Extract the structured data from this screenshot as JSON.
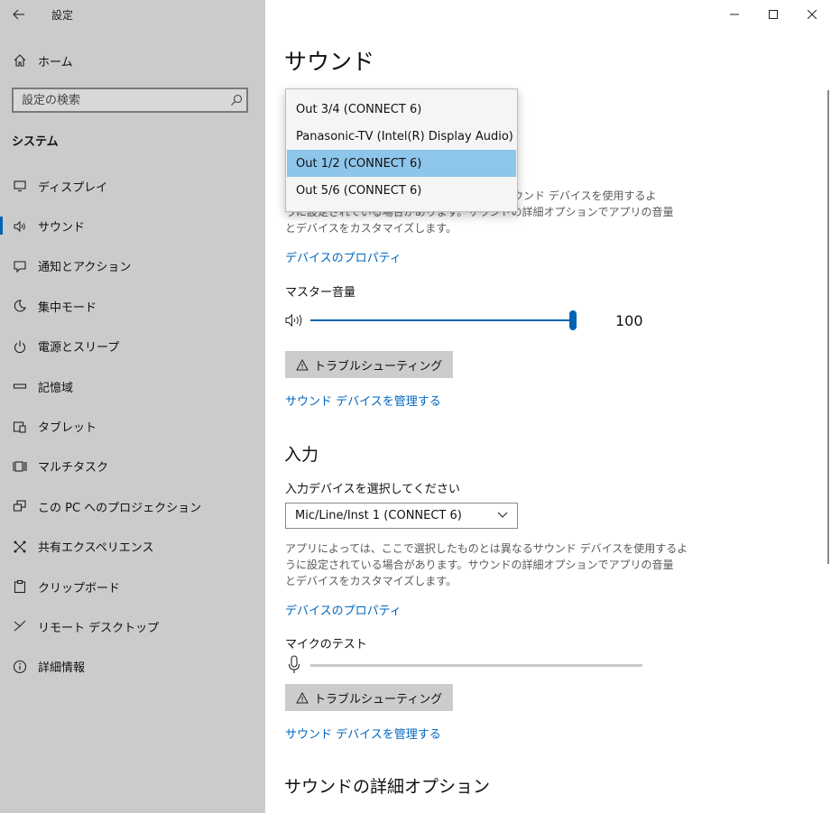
{
  "app": {
    "title": "設定"
  },
  "window_controls": {
    "minimize": "—",
    "maximize": "☐",
    "close": "✕"
  },
  "sidebar": {
    "home_label": "ホーム",
    "search_placeholder": "設定の検索",
    "section_title": "システム",
    "items": [
      {
        "label": "ディスプレイ",
        "icon": "display-icon"
      },
      {
        "label": "サウンド",
        "icon": "speaker-icon",
        "active": true
      },
      {
        "label": "通知とアクション",
        "icon": "notification-icon"
      },
      {
        "label": "集中モード",
        "icon": "moon-icon"
      },
      {
        "label": "電源とスリープ",
        "icon": "power-icon"
      },
      {
        "label": "記憶域",
        "icon": "storage-icon"
      },
      {
        "label": "タブレット",
        "icon": "tablet-icon"
      },
      {
        "label": "マルチタスク",
        "icon": "multitask-icon"
      },
      {
        "label": "この PC へのプロジェクション",
        "icon": "projection-icon"
      },
      {
        "label": "共有エクスペリエンス",
        "icon": "shared-icon"
      },
      {
        "label": "クリップボード",
        "icon": "clipboard-icon"
      },
      {
        "label": "リモート デスクトップ",
        "icon": "remote-icon"
      },
      {
        "label": "詳細情報",
        "icon": "info-icon"
      }
    ]
  },
  "main": {
    "page_title": "サウンド",
    "output": {
      "description_partial": "ウンド デバイスを使用するよう に設定されている場合があります。サウンドの詳細オプションでアプリの音量とデバイスをカスタマイズします。",
      "desc_line1": "ウンド デバイスを使用するよ",
      "desc_line2": "うに設定されている場合があります。サウンドの詳細オプションでアプリの音量",
      "desc_line3": "とデバイスをカスタマイズします。",
      "device_properties_link": "デバイスのプロパティ",
      "master_volume_label": "マスター音量",
      "volume_value": "100",
      "volume_level": 1.0,
      "troubleshoot_label": "トラブルシューティング",
      "manage_devices_link": "サウンド デバイスを管理する",
      "dropdown_options": [
        "Out 3/4 (CONNECT 6)",
        "Panasonic-TV (Intel(R) Display Audio)",
        "Out 1/2 (CONNECT 6)",
        "Out 5/6 (CONNECT 6)"
      ],
      "dropdown_selected_index": 2
    },
    "input": {
      "heading": "入力",
      "select_label": "入力デバイスを選択してください",
      "selected_device": "Mic/Line/Inst 1 (CONNECT 6)",
      "desc_line1": "アプリによっては、ここで選択したものとは異なるサウンド デバイスを使用するよ",
      "desc_line2": "うに設定されている場合があります。サウンドの詳細オプションでアプリの音量",
      "desc_line3": "とデバイスをカスタマイズします。",
      "device_properties_link": "デバイスのプロパティ",
      "mic_test_label": "マイクのテスト",
      "mic_level": 0,
      "troubleshoot_label": "トラブルシューティング",
      "manage_devices_link": "サウンド デバイスを管理する"
    },
    "advanced_heading": "サウンドの詳細オプション"
  },
  "colors": {
    "accent": "#0063b1",
    "link": "#0067c0",
    "sidebar_bg": "#cbcbcb",
    "dropdown_selected": "#8ec5ea"
  }
}
